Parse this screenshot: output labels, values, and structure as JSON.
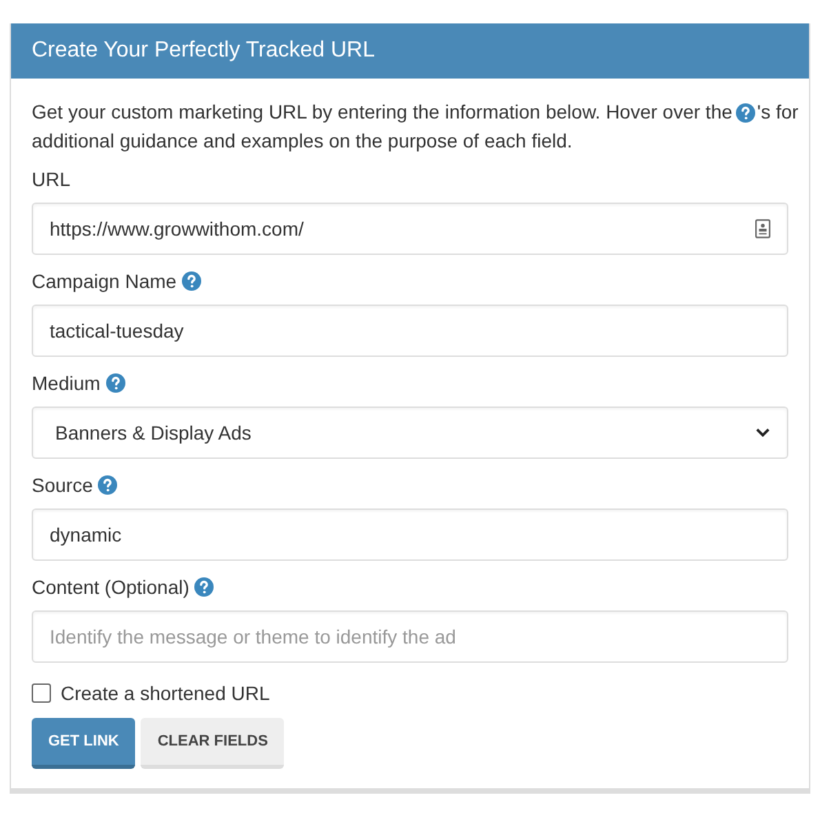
{
  "panel": {
    "title": "Create Your Perfectly Tracked URL"
  },
  "intro": {
    "before": "Get your custom marketing URL by entering the information below. Hover over the",
    "after": "'s for",
    "second_line": "additional guidance and examples on the purpose of each field."
  },
  "fields": [
    {
      "kind": "url",
      "label": "URL",
      "help": false,
      "value": "https://www.growwithom.com/"
    },
    {
      "kind": "text",
      "label": "Campaign Name",
      "help": true,
      "value": "tactical-tuesday"
    },
    {
      "kind": "select",
      "label": "Medium",
      "help": true,
      "value": "Banners & Display Ads"
    },
    {
      "kind": "text",
      "label": "Source",
      "help": true,
      "value": "dynamic"
    },
    {
      "kind": "text",
      "label": "Content (Optional)",
      "help": true,
      "placeholder": "Identify the message or theme to identify the ad"
    }
  ],
  "shorten": {
    "label": "Create a shortened URL",
    "checked": false
  },
  "buttons": [
    {
      "label": "GET LINK",
      "kind": "primary"
    },
    {
      "label": "CLEAR FIELDS",
      "kind": "secondary"
    }
  ]
}
